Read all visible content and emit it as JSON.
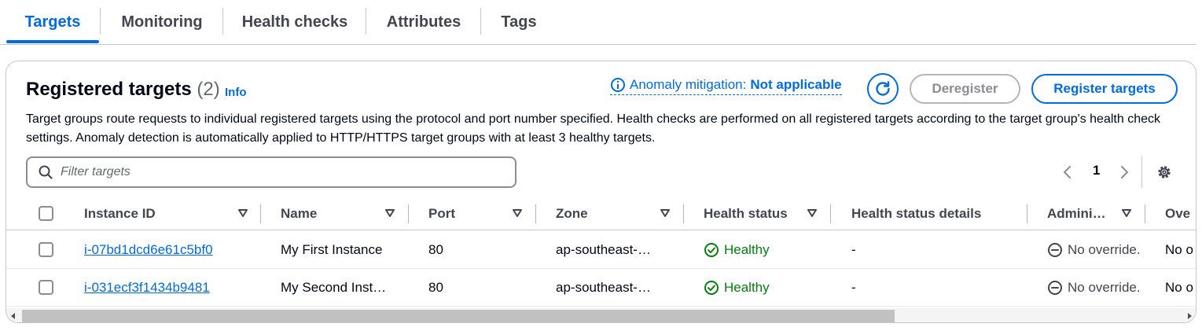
{
  "tabs": [
    {
      "label": "Targets",
      "active": true
    },
    {
      "label": "Monitoring"
    },
    {
      "label": "Health checks"
    },
    {
      "label": "Attributes"
    },
    {
      "label": "Tags"
    }
  ],
  "panel": {
    "title": "Registered targets",
    "count": "(2)",
    "info": "Info",
    "anomaly_label": "Anomaly mitigation:",
    "anomaly_value": "Not applicable",
    "deregister_label": "Deregister",
    "register_label": "Register targets",
    "description": "Target groups route requests to individual registered targets using the protocol and port number specified. Health checks are performed on all registered targets according to the target group's health check settings. Anomaly detection is automatically applied to HTTP/HTTPS target groups with at least 3 healthy targets."
  },
  "filter": {
    "placeholder": "Filter targets",
    "value": ""
  },
  "pagination": {
    "current_page": "1"
  },
  "table": {
    "columns": [
      "Instance ID",
      "Name",
      "Port",
      "Zone",
      "Health status",
      "Health status details",
      "Admini…",
      "Ove"
    ],
    "rows": [
      {
        "instance_id": "i-07bd1dcd6e61c5bf0",
        "name": "My First Instance",
        "port": "80",
        "zone": "ap-southeast-…",
        "health": "Healthy",
        "details": "-",
        "admin": "No override.",
        "override": "No o"
      },
      {
        "instance_id": "i-031ecf3f1434b9481",
        "name": "My Second Inst…",
        "port": "80",
        "zone": "ap-southeast-…",
        "health": "Healthy",
        "details": "-",
        "admin": "No override.",
        "override": "No o"
      }
    ]
  },
  "colors": {
    "accent": "#006ce0",
    "healthy": "#037f0c",
    "border": "#c6c6cd"
  },
  "icons": [
    "info-icon",
    "refresh-icon",
    "search-icon",
    "chevron-left-icon",
    "chevron-right-icon",
    "gear-icon",
    "sort-down-icon",
    "check-circle-icon",
    "minus-circle-icon"
  ]
}
